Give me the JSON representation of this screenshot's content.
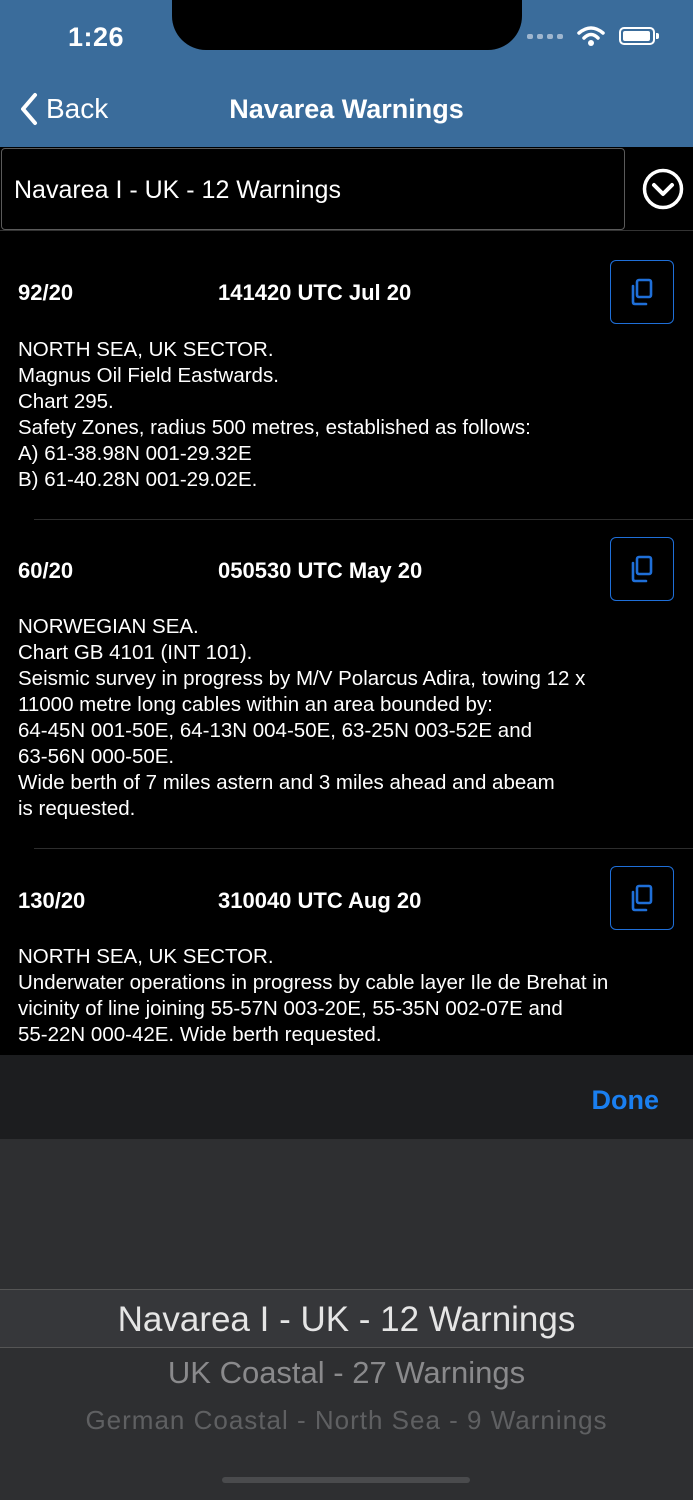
{
  "status_bar": {
    "time": "1:26"
  },
  "nav": {
    "back_label": "Back",
    "title": "Navarea Warnings"
  },
  "selector": {
    "value": "Navarea I - UK  -  12 Warnings"
  },
  "warnings": [
    {
      "id": "92/20",
      "datetime": "141420 UTC Jul 20",
      "body": "NORTH SEA, UK SECTOR.\nMagnus Oil Field Eastwards.\nChart 295.\nSafety Zones, radius 500 metres, established as follows:\nA) 61-38.98N 001-29.32E\nB) 61-40.28N 001-29.02E."
    },
    {
      "id": "60/20",
      "datetime": "050530 UTC May 20",
      "body": "NORWEGIAN SEA.\nChart GB 4101 (INT 101).\nSeismic survey in progress by M/V Polarcus Adira, towing 12 x\n11000 metre long cables within an area bounded by:\n64-45N 001-50E, 64-13N 004-50E, 63-25N 003-52E and\n63-56N 000-50E.\nWide berth of 7 miles astern and 3 miles ahead and abeam\nis requested."
    },
    {
      "id": "130/20",
      "datetime": "310040 UTC Aug 20",
      "body": "NORTH SEA, UK SECTOR.\nUnderwater operations in progress by cable layer Ile de Brehat in\nvicinity of line joining 55-57N 003-20E, 55-35N 002-07E and\n55-22N 000-42E.  Wide berth requested."
    }
  ],
  "picker": {
    "done_label": "Done",
    "options": [
      "Navarea I - UK  -  12 Warnings",
      "UK Coastal  -  27 Warnings",
      "German Coastal - North Sea  -  9 Warnings"
    ],
    "selected_index": 0
  },
  "colors": {
    "header": "#3a6c9b",
    "accent": "#1a7ff0",
    "background": "#000000"
  },
  "icons": [
    "back-chevron-icon",
    "chevron-down-circle-icon",
    "copy-icon",
    "wifi-icon",
    "battery-icon",
    "signal-icon"
  ]
}
